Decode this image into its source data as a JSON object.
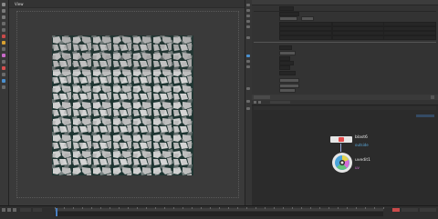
{
  "viewport": {
    "label": "View"
  },
  "network": {
    "nodes": [
      {
        "name": "blast6",
        "subtitle": "outside",
        "subtitle_color": "#5aa7d8"
      },
      {
        "name": "uvedit1",
        "subtitle": "uv",
        "subtitle_color": "#d873d8"
      }
    ]
  },
  "colors": {
    "viewport_bg": "#3a3a3a",
    "node_wire": "#99aadd",
    "blast_flag": "#e34b4b",
    "timeline_accent": "#4a7fc0"
  }
}
